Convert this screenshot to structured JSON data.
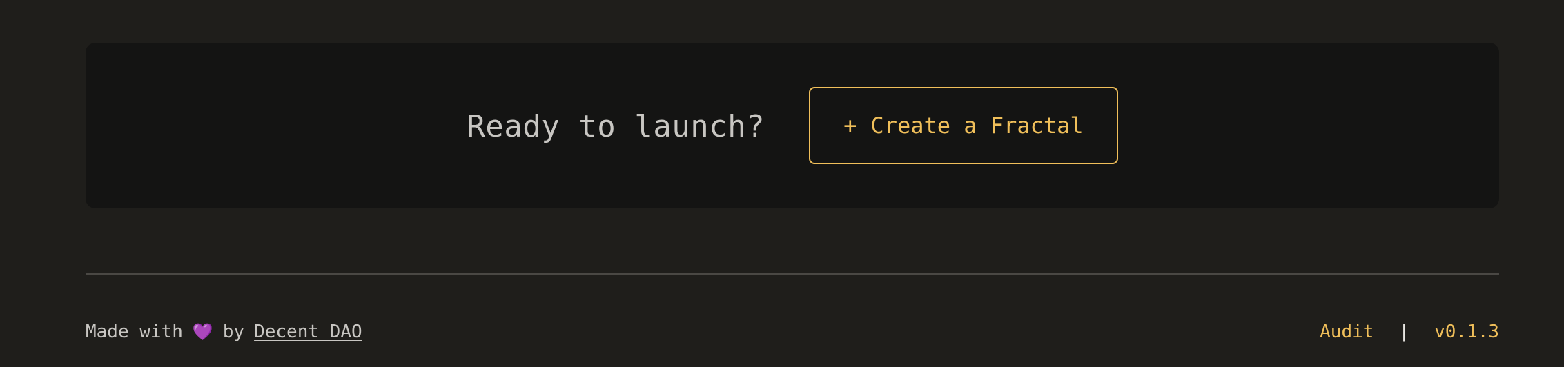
{
  "colors": {
    "page_bg": "#1f1e1b",
    "card_bg": "#141413",
    "accent": "#f0bf5a",
    "text": "#c8c6c2",
    "heart": "#a55ee8"
  },
  "cta": {
    "heading": "Ready to launch?",
    "button_plus": "+",
    "button_label": "Create a Fractal"
  },
  "footer": {
    "made_with": "Made with",
    "heart_icon": "purple-heart",
    "heart_glyph": "💜",
    "by": "by",
    "link_label": "Decent DAO",
    "audit_label": "Audit",
    "separator": "|",
    "version": "v0.1.3"
  }
}
